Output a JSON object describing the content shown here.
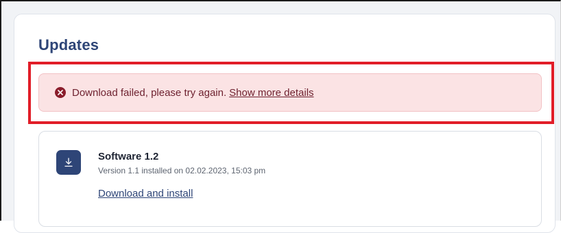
{
  "page": {
    "title": "Updates"
  },
  "alert": {
    "icon": "error-circle-icon",
    "message": "Download failed, please try again.",
    "link_label": "Show more details"
  },
  "update": {
    "icon": "download-icon",
    "name": "Software 1.2",
    "version_info": "Version 1.1 installed on 02.02.2023, 15:03 pm",
    "action_label": "Download and install"
  },
  "colors": {
    "accent": "#2e4577",
    "alert_background": "#fbe3e4",
    "alert_text": "#6e2230",
    "highlight_border": "#e11d28"
  }
}
